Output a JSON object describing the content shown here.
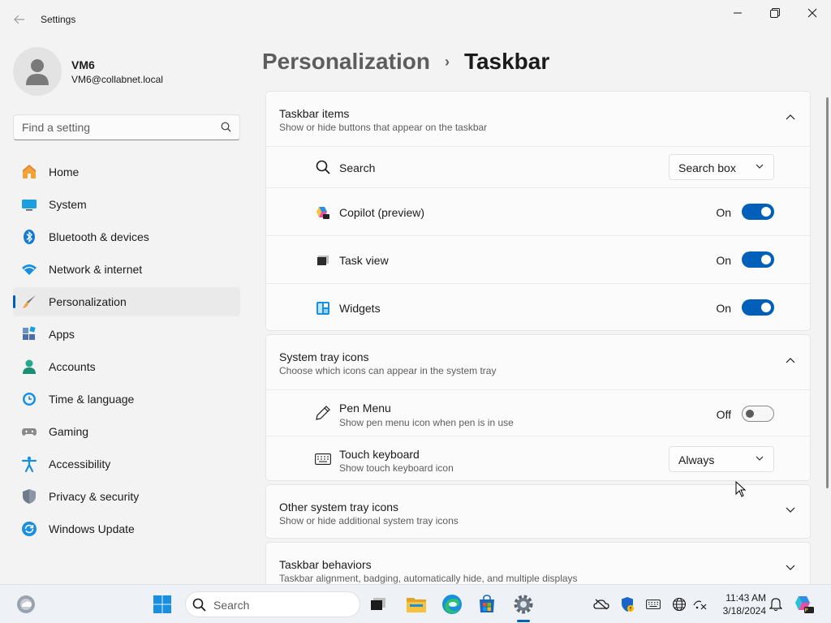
{
  "app": {
    "title": "Settings"
  },
  "profile": {
    "name": "VM6",
    "email": "VM6@collabnet.local"
  },
  "search": {
    "placeholder": "Find a setting"
  },
  "nav": {
    "items": [
      {
        "label": "Home",
        "icon": "home-icon"
      },
      {
        "label": "System",
        "icon": "system-icon"
      },
      {
        "label": "Bluetooth & devices",
        "icon": "bluetooth-icon"
      },
      {
        "label": "Network & internet",
        "icon": "network-icon"
      },
      {
        "label": "Personalization",
        "icon": "brush-icon",
        "active": true
      },
      {
        "label": "Apps",
        "icon": "apps-icon"
      },
      {
        "label": "Accounts",
        "icon": "accounts-icon"
      },
      {
        "label": "Time & language",
        "icon": "time-icon"
      },
      {
        "label": "Gaming",
        "icon": "gaming-icon"
      },
      {
        "label": "Accessibility",
        "icon": "accessibility-icon"
      },
      {
        "label": "Privacy & security",
        "icon": "shield-icon"
      },
      {
        "label": "Windows Update",
        "icon": "update-icon"
      }
    ]
  },
  "breadcrumb": {
    "parent": "Personalization",
    "separator": "›",
    "current": "Taskbar"
  },
  "taskbar_items": {
    "title": "Taskbar items",
    "subtitle": "Show or hide buttons that appear on the taskbar",
    "rows": {
      "search": {
        "label": "Search",
        "value": "Search box"
      },
      "copilot": {
        "label": "Copilot (preview)",
        "state": "On"
      },
      "taskview": {
        "label": "Task view",
        "state": "On"
      },
      "widgets": {
        "label": "Widgets",
        "state": "On"
      }
    }
  },
  "system_tray": {
    "title": "System tray icons",
    "subtitle": "Choose which icons can appear in the system tray",
    "rows": {
      "pen": {
        "label": "Pen Menu",
        "sub": "Show pen menu icon when pen is in use",
        "state": "Off"
      },
      "touch": {
        "label": "Touch keyboard",
        "sub": "Show touch keyboard icon",
        "value": "Always"
      }
    }
  },
  "other_tray": {
    "title": "Other system tray icons",
    "subtitle": "Show or hide additional system tray icons"
  },
  "behaviors": {
    "title": "Taskbar behaviors",
    "subtitle": "Taskbar alignment, badging, automatically hide, and multiple displays"
  },
  "taskbar": {
    "search_label": "Search",
    "time": "11:43 AM",
    "date": "3/18/2024"
  },
  "colors": {
    "accent": "#005fb8",
    "background": "#f3f3f3",
    "card": "#fbfbfb"
  }
}
